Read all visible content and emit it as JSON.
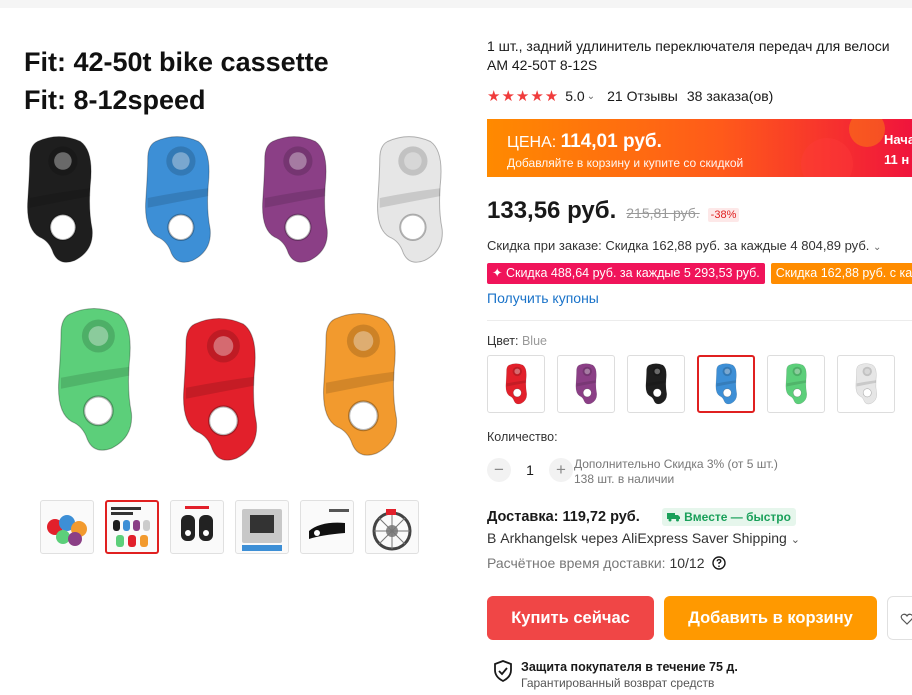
{
  "gallery": {
    "fit_line_1": "Fit: 42-50t bike cassette",
    "fit_line_2": "Fit: 8-12speed",
    "hanger_colors": [
      "#1e1e1e",
      "#3d8fd6",
      "#8b3f86",
      "#e6e6e6",
      "#5ccf7a",
      "#e2202b",
      "#f29a2e"
    ],
    "thumb_count": 6,
    "active_thumb_index": 1
  },
  "product": {
    "title_line_1": "1 шт., задний удлинитель переключателя передач для велоси",
    "title_line_2": "AM 42-50T 8-12S",
    "rating": "5.0",
    "reviews": "21 Отзывы",
    "orders": "38 заказа(ов)"
  },
  "promo": {
    "price_label": "ЦЕНА: ",
    "price_value": "114,01 руб.",
    "subtitle": "Добавляйте в корзину и купите со скидкой",
    "right_line_1": "Нача",
    "right_line_2": "11 н"
  },
  "price": {
    "current": "133,56 руб.",
    "old": "215,81 руб.",
    "discount": "-38%"
  },
  "order_discount": {
    "text": "Скидка при заказе: Скидка 162,88 руб. за каждые 4 804,89 руб."
  },
  "chips": {
    "pink": "✦ Скидка 488,64 руб. за каждые 5 293,53 руб.",
    "orange": "Скидка 162,88 руб. с каж"
  },
  "coupons_link": "Получить купоны",
  "color": {
    "label": "Цвет: ",
    "selected": "Blue",
    "swatches": [
      {
        "color": "#e2202b"
      },
      {
        "color": "#8b3f86"
      },
      {
        "color": "#1e1e1e"
      },
      {
        "color": "#3d8fd6"
      },
      {
        "color": "#5ccf7a"
      },
      {
        "color": "#e6e6e6"
      }
    ],
    "selected_index": 3
  },
  "quantity": {
    "label": "Количество:",
    "value": "1",
    "minus": "−",
    "plus": "+",
    "info_1": "Дополнительно Скидка 3% (от 5 шт.)",
    "info_2": "138 шт. в наличии"
  },
  "delivery": {
    "label": "Доставка: 119,72 руб.",
    "badge": "Вместе — быстро",
    "ship_line": "В Arkhangelsk через AliExpress Saver Shipping",
    "est_label": "Расчётное время доставки: ",
    "est_date": "10/12"
  },
  "buttons": {
    "buy_now": "Купить сейчас",
    "add_to_cart": "Добавить в корзину"
  },
  "protection": {
    "title": "Защита покупателя в течение 75 д.",
    "subtitle": "Гарантированный возврат средств"
  }
}
